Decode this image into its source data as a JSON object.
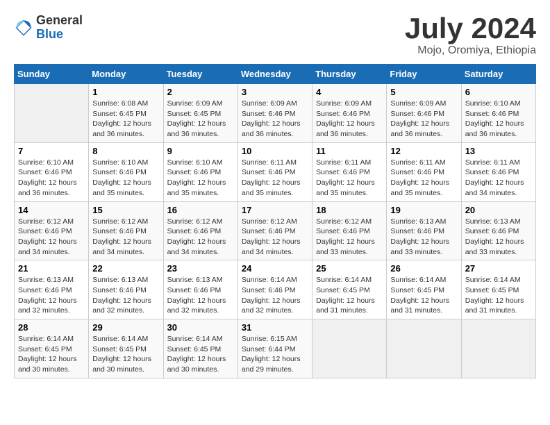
{
  "logo": {
    "general": "General",
    "blue": "Blue"
  },
  "title": "July 2024",
  "location": "Mojo, Oromiya, Ethiopia",
  "days_of_week": [
    "Sunday",
    "Monday",
    "Tuesday",
    "Wednesday",
    "Thursday",
    "Friday",
    "Saturday"
  ],
  "weeks": [
    [
      {
        "day": "",
        "info": ""
      },
      {
        "day": "1",
        "info": "Sunrise: 6:08 AM\nSunset: 6:45 PM\nDaylight: 12 hours\nand 36 minutes."
      },
      {
        "day": "2",
        "info": "Sunrise: 6:09 AM\nSunset: 6:45 PM\nDaylight: 12 hours\nand 36 minutes."
      },
      {
        "day": "3",
        "info": "Sunrise: 6:09 AM\nSunset: 6:46 PM\nDaylight: 12 hours\nand 36 minutes."
      },
      {
        "day": "4",
        "info": "Sunrise: 6:09 AM\nSunset: 6:46 PM\nDaylight: 12 hours\nand 36 minutes."
      },
      {
        "day": "5",
        "info": "Sunrise: 6:09 AM\nSunset: 6:46 PM\nDaylight: 12 hours\nand 36 minutes."
      },
      {
        "day": "6",
        "info": "Sunrise: 6:10 AM\nSunset: 6:46 PM\nDaylight: 12 hours\nand 36 minutes."
      }
    ],
    [
      {
        "day": "7",
        "info": "Sunrise: 6:10 AM\nSunset: 6:46 PM\nDaylight: 12 hours\nand 36 minutes."
      },
      {
        "day": "8",
        "info": "Sunrise: 6:10 AM\nSunset: 6:46 PM\nDaylight: 12 hours\nand 35 minutes."
      },
      {
        "day": "9",
        "info": "Sunrise: 6:10 AM\nSunset: 6:46 PM\nDaylight: 12 hours\nand 35 minutes."
      },
      {
        "day": "10",
        "info": "Sunrise: 6:11 AM\nSunset: 6:46 PM\nDaylight: 12 hours\nand 35 minutes."
      },
      {
        "day": "11",
        "info": "Sunrise: 6:11 AM\nSunset: 6:46 PM\nDaylight: 12 hours\nand 35 minutes."
      },
      {
        "day": "12",
        "info": "Sunrise: 6:11 AM\nSunset: 6:46 PM\nDaylight: 12 hours\nand 35 minutes."
      },
      {
        "day": "13",
        "info": "Sunrise: 6:11 AM\nSunset: 6:46 PM\nDaylight: 12 hours\nand 34 minutes."
      }
    ],
    [
      {
        "day": "14",
        "info": "Sunrise: 6:12 AM\nSunset: 6:46 PM\nDaylight: 12 hours\nand 34 minutes."
      },
      {
        "day": "15",
        "info": "Sunrise: 6:12 AM\nSunset: 6:46 PM\nDaylight: 12 hours\nand 34 minutes."
      },
      {
        "day": "16",
        "info": "Sunrise: 6:12 AM\nSunset: 6:46 PM\nDaylight: 12 hours\nand 34 minutes."
      },
      {
        "day": "17",
        "info": "Sunrise: 6:12 AM\nSunset: 6:46 PM\nDaylight: 12 hours\nand 34 minutes."
      },
      {
        "day": "18",
        "info": "Sunrise: 6:12 AM\nSunset: 6:46 PM\nDaylight: 12 hours\nand 33 minutes."
      },
      {
        "day": "19",
        "info": "Sunrise: 6:13 AM\nSunset: 6:46 PM\nDaylight: 12 hours\nand 33 minutes."
      },
      {
        "day": "20",
        "info": "Sunrise: 6:13 AM\nSunset: 6:46 PM\nDaylight: 12 hours\nand 33 minutes."
      }
    ],
    [
      {
        "day": "21",
        "info": "Sunrise: 6:13 AM\nSunset: 6:46 PM\nDaylight: 12 hours\nand 32 minutes."
      },
      {
        "day": "22",
        "info": "Sunrise: 6:13 AM\nSunset: 6:46 PM\nDaylight: 12 hours\nand 32 minutes."
      },
      {
        "day": "23",
        "info": "Sunrise: 6:13 AM\nSunset: 6:46 PM\nDaylight: 12 hours\nand 32 minutes."
      },
      {
        "day": "24",
        "info": "Sunrise: 6:14 AM\nSunset: 6:46 PM\nDaylight: 12 hours\nand 32 minutes."
      },
      {
        "day": "25",
        "info": "Sunrise: 6:14 AM\nSunset: 6:45 PM\nDaylight: 12 hours\nand 31 minutes."
      },
      {
        "day": "26",
        "info": "Sunrise: 6:14 AM\nSunset: 6:45 PM\nDaylight: 12 hours\nand 31 minutes."
      },
      {
        "day": "27",
        "info": "Sunrise: 6:14 AM\nSunset: 6:45 PM\nDaylight: 12 hours\nand 31 minutes."
      }
    ],
    [
      {
        "day": "28",
        "info": "Sunrise: 6:14 AM\nSunset: 6:45 PM\nDaylight: 12 hours\nand 30 minutes."
      },
      {
        "day": "29",
        "info": "Sunrise: 6:14 AM\nSunset: 6:45 PM\nDaylight: 12 hours\nand 30 minutes."
      },
      {
        "day": "30",
        "info": "Sunrise: 6:14 AM\nSunset: 6:45 PM\nDaylight: 12 hours\nand 30 minutes."
      },
      {
        "day": "31",
        "info": "Sunrise: 6:15 AM\nSunset: 6:44 PM\nDaylight: 12 hours\nand 29 minutes."
      },
      {
        "day": "",
        "info": ""
      },
      {
        "day": "",
        "info": ""
      },
      {
        "day": "",
        "info": ""
      }
    ]
  ]
}
